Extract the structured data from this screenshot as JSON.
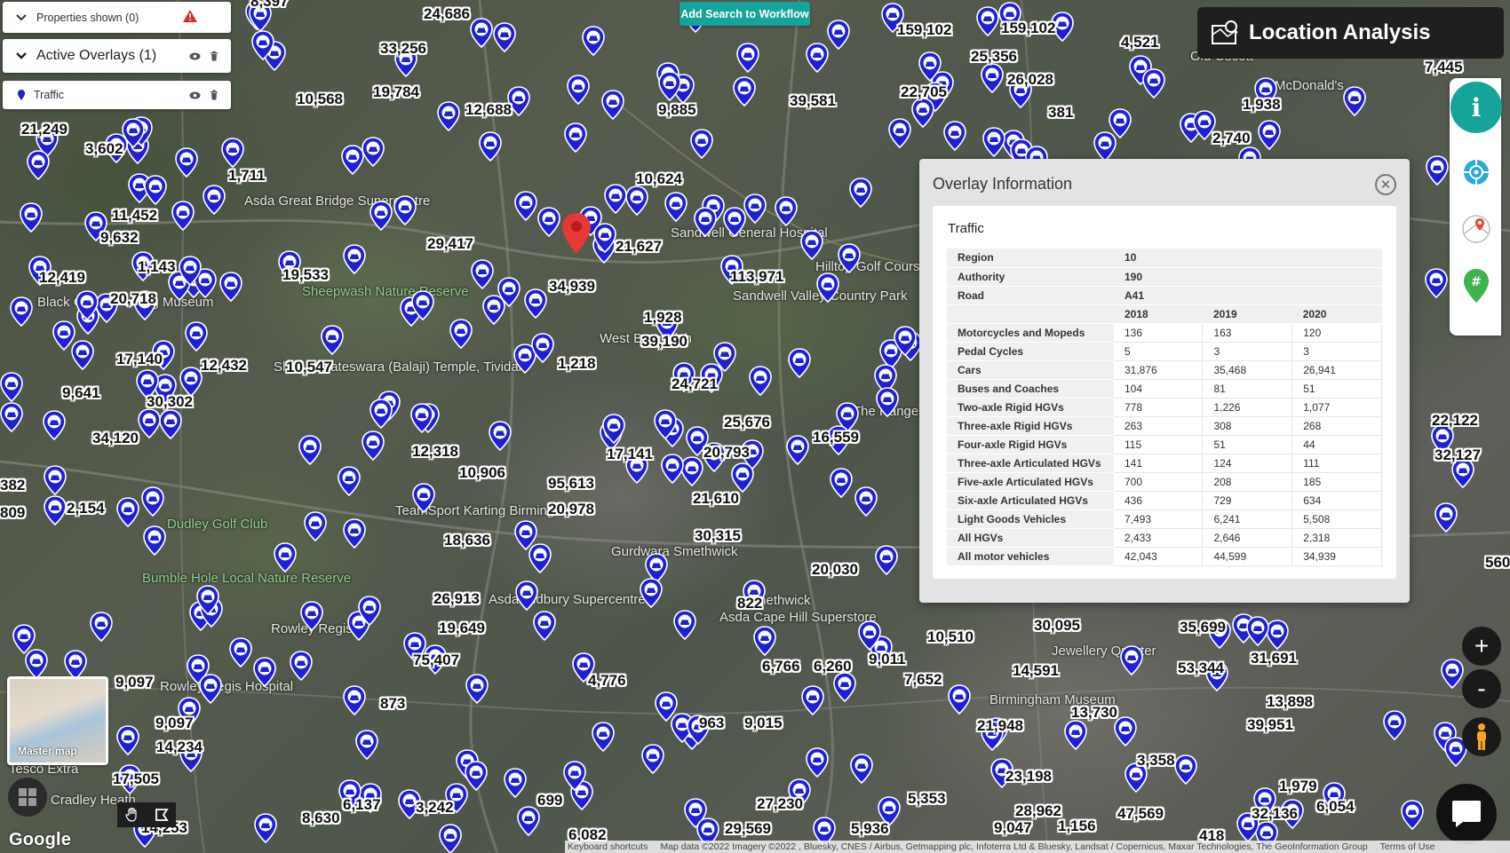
{
  "toolbar": {
    "properties_label": "Properties shown (0)",
    "overlays_label": "Active Overlays (1)",
    "traffic_label": "Traffic",
    "add_search_label": "Add Search to Workflow"
  },
  "header": {
    "title": "Location Analysis"
  },
  "overlay_info": {
    "title": "Overlay Information",
    "card_title": "Traffic",
    "meta": [
      {
        "label": "Region",
        "value": "10"
      },
      {
        "label": "Authority",
        "value": "190"
      },
      {
        "label": "Road",
        "value": "A41"
      }
    ],
    "years": [
      "2018",
      "2019",
      "2020"
    ],
    "rows": [
      {
        "label": "Motorcycles and Mopeds",
        "values": [
          "136",
          "163",
          "120"
        ]
      },
      {
        "label": "Pedal Cycles",
        "values": [
          "5",
          "3",
          "3"
        ]
      },
      {
        "label": "Cars",
        "values": [
          "31,876",
          "35,468",
          "26,941"
        ]
      },
      {
        "label": "Buses and Coaches",
        "values": [
          "104",
          "81",
          "51"
        ]
      },
      {
        "label": "Two-axle Rigid HGVs",
        "values": [
          "778",
          "1,226",
          "1,077"
        ]
      },
      {
        "label": "Three-axle Rigid HGVs",
        "values": [
          "263",
          "308",
          "268"
        ]
      },
      {
        "label": "Four-axle Rigid HGVs",
        "values": [
          "115",
          "51",
          "44"
        ]
      },
      {
        "label": "Three-axle Articulated HGVs",
        "values": [
          "141",
          "124",
          "111"
        ]
      },
      {
        "label": "Five-axle Articulated HGVs",
        "values": [
          "700",
          "208",
          "185"
        ]
      },
      {
        "label": "Six-axle Articulated HGVs",
        "values": [
          "436",
          "729",
          "634"
        ]
      },
      {
        "label": "Light Goods Vehicles",
        "values": [
          "7,493",
          "6,241",
          "5,508"
        ]
      },
      {
        "label": "All HGVs",
        "values": [
          "2,433",
          "2,646",
          "2,318"
        ]
      },
      {
        "label": "All motor vehicles",
        "values": [
          "42,043",
          "44,599",
          "34,939"
        ]
      }
    ]
  },
  "map": {
    "place_labels": [
      "Asda Great Bridge Supercentre",
      "Sheepwash Nature Reserve",
      "Sandwell General Hospital",
      "Hilltop Golf Course",
      "Sandwell Valley Country Park",
      "West Bromwich",
      "Black Country Living Museum",
      "Shri Venkateswara (Balaji) Temple, Tividale",
      "Dudley Golf Club",
      "TeamSport Karting Birmingham",
      "Gurdwara Smethwick",
      "Asda Oldbury Supercentre",
      "Rowley Regis",
      "Rowley Regis Hospital",
      "Bumble Hole Local Nature Reserve",
      "Asda Cape Hill Superstore",
      "McDonald's",
      "Old Oscott",
      "The Range West Bromwich",
      "Smethwick",
      "Tesco Extra",
      "Cradley Heath",
      "Birmingham Museum",
      "Jewellery Quarter"
    ],
    "counts": [
      "8,397",
      "24,686",
      "33,256",
      "19,784",
      "10,568",
      "12,688",
      "9,885",
      "39,581",
      "159,102",
      "159,102",
      "4,521",
      "25,356",
      "26,028",
      "22,705",
      "381",
      "1,938",
      "7,445",
      "2,740",
      "21,249",
      "3,602",
      "1,711",
      "11,452",
      "9,632",
      "1,143",
      "12,419",
      "20,718",
      "19,533",
      "29,417",
      "21,627",
      "34,939",
      "113,971",
      "10,624",
      "1,928",
      "39,190",
      "1,218",
      "17,140",
      "12,432",
      "10,547",
      "9,641",
      "30,302",
      "34,120",
      "24,721",
      "25,676",
      "16,559",
      "12,318",
      "10,906",
      "17,141",
      "20,793",
      "95,613",
      "20,978",
      "21,610",
      "2,154",
      "18,636",
      "30,315",
      "20,030",
      "26,913",
      "19,649",
      "822",
      "75,407",
      "4,776",
      "9,097",
      "9,097",
      "14,234",
      "873",
      "963",
      "9,015",
      "6,766",
      "6,260",
      "9,011",
      "7,652",
      "10,510",
      "30,095",
      "14,591",
      "35,699",
      "31,691",
      "53,344",
      "13,898",
      "13,730",
      "21,948",
      "39,951",
      "3,358",
      "23,198",
      "1,979",
      "17,505",
      "6,137",
      "3,242",
      "699",
      "27,230",
      "5,353",
      "28,962",
      "47,569",
      "32,136",
      "6,054",
      "8,630",
      "14,253",
      "6,082",
      "29,569",
      "5,936",
      "9,047",
      "1,156",
      "418",
      "22,122",
      "32,127",
      "382",
      "809",
      "560"
    ],
    "selected_pin_color": "#e53935",
    "traffic_pin_color": "#1f1fd6"
  },
  "controls": {
    "master_map_label": "Master map",
    "zoom_in": "+",
    "zoom_out": "-",
    "google": "Google"
  },
  "attribution": {
    "keyboard": "Keyboard shortcuts",
    "data": "Map data ©2022 Imagery ©2022 , Bluesky, CNES / Airbus, Getmapping plc, Infoterra Ltd & Bluesky, Landsat / Copernicus, Maxar Technologies, The GeoInformation Group",
    "terms": "Terms of Use"
  },
  "colors": {
    "accent": "#16a39a",
    "title_bar": "#1f1f1f"
  }
}
